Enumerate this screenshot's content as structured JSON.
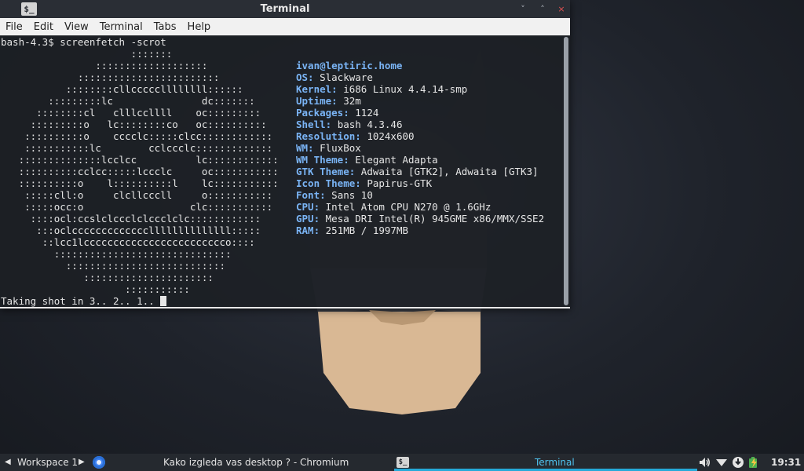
{
  "window": {
    "title": "Terminal",
    "app_icon": "terminal-icon",
    "app_icon_text": "$_",
    "controls": {
      "minimize": "˅",
      "maximize": "˄",
      "close": "×"
    }
  },
  "menu": [
    "File",
    "Edit",
    "View",
    "Terminal",
    "Tabs",
    "Help"
  ],
  "terminal": {
    "command_line": "bash-4.3$ screenfetch -scrot",
    "ascii_art": [
      "                      :::::::",
      "                :::::::::::::::::::",
      "             ::::::::::::::::::::::::",
      "           ::::::::cllcccccllllllll::::::",
      "        :::::::::lc               dc:::::::",
      "      ::::::::cl   clllccllll    oc:::::::::",
      "     :::::::::o   lc::::::::co   oc::::::::::",
      "    ::::::::::o    cccclc:::::clcc::::::::::::",
      "    :::::::::::lc        cclccclc:::::::::::::",
      "   ::::::::::::::lcclcc          lc::::::::::::",
      "   ::::::::::cclcc:::::lccclc     oc:::::::::::",
      "   ::::::::::o    l::::::::::l    lc:::::::::::",
      "    :::::cll:o     clcllcccll     o:::::::::::",
      "    :::::occ:o                  clc:::::::::::",
      "     ::::ocl:ccslclccclclccclclc::::::::::::",
      "      :::oclcccccccccccccllllllllllllll:::::",
      "       ::lcc1lcccccccccccccccccccccccco::::",
      "         ::::::::::::::::::::::::::::::",
      "           :::::::::::::::::::::::::::",
      "              ::::::::::::::::::::::",
      "                     :::::::::::"
    ],
    "user_host": "ivan@leptiric.home",
    "info": [
      {
        "key": "OS:",
        "value": "Slackware"
      },
      {
        "key": "Kernel:",
        "value": "i686 Linux 4.4.14-smp"
      },
      {
        "key": "Uptime:",
        "value": "32m"
      },
      {
        "key": "Packages:",
        "value": "1124"
      },
      {
        "key": "Shell:",
        "value": "bash 4.3.46"
      },
      {
        "key": "Resolution:",
        "value": "1024x600"
      },
      {
        "key": "WM:",
        "value": "FluxBox"
      },
      {
        "key": "WM Theme:",
        "value": "Elegant Adapta"
      },
      {
        "key": "GTK Theme:",
        "value": "Adwaita [GTK2], Adwaita [GTK3]"
      },
      {
        "key": "Icon Theme:",
        "value": "Papirus-GTK"
      },
      {
        "key": "Font:",
        "value": "Sans 10"
      },
      {
        "key": "CPU:",
        "value": "Intel Atom CPU N270 @ 1.6GHz"
      },
      {
        "key": "GPU:",
        "value": "Mesa DRI Intel(R) 945GME x86/MMX/SSE2"
      },
      {
        "key": "RAM:",
        "value": "251MB / 1997MB"
      }
    ],
    "status_line": "Taking shot in 3.. 2.. 1.. "
  },
  "taskbar": {
    "prev_workspace": "◀",
    "workspace": "Workspace 1",
    "next_workspace": "▶",
    "tasks": [
      {
        "label": "Kako izgleda vas desktop ? - Chromium",
        "icon": "chromium-icon",
        "active": false
      },
      {
        "label": "Terminal",
        "icon": "terminal-icon",
        "icon_text": "$_",
        "active": true
      }
    ],
    "tray": [
      "volume-icon",
      "wifi-icon",
      "download-icon",
      "battery-charging-icon"
    ],
    "clock": "19:31"
  },
  "colors": {
    "accent": "#25aad9",
    "info_key": "#7ab4f5",
    "wallpaper_mask_dark": "#3b3f46",
    "wallpaper_face": "#d9b894"
  }
}
